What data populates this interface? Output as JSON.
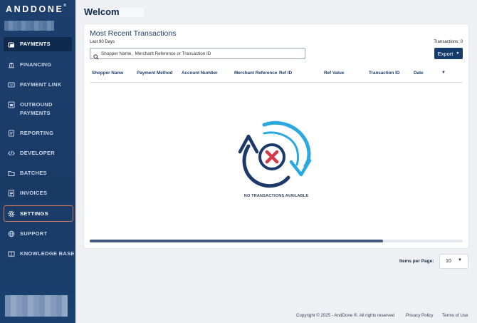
{
  "app": {
    "logo": "ANDDONE",
    "logo_mark": "®"
  },
  "sidebar": {
    "items": [
      {
        "label": "PAYMENTS",
        "icon": "payments-icon"
      },
      {
        "label": "FINANCING",
        "icon": "bank-icon"
      },
      {
        "label": "PAYMENT LINK",
        "icon": "payment-link-icon"
      },
      {
        "label": "OUTBOUND",
        "label2": "PAYMENTS",
        "icon": "outbound-payments-icon"
      },
      {
        "label": "REPORTING",
        "icon": "report-icon"
      },
      {
        "label": "DEVELOPER",
        "icon": "code-icon"
      },
      {
        "label": "BATCHES",
        "icon": "folder-icon"
      },
      {
        "label": "INVOICES",
        "icon": "invoice-icon"
      },
      {
        "label": "SETTINGS",
        "icon": "gear-icon"
      },
      {
        "label": "SUPPORT",
        "icon": "globe-icon"
      },
      {
        "label": "KNOWLEDGE BASE",
        "icon": "book-icon"
      }
    ]
  },
  "header": {
    "welcome": "Welcome,"
  },
  "transactions": {
    "title": "Most Recent Transactions",
    "subtitle": "Last 90 Days",
    "count_label": "Transactions: 0",
    "search_placeholder": "Shopper Name,  Merchant Reference or Transaction ID",
    "export_label": "Export",
    "columns": [
      "Shopper Name",
      "Payment Method",
      "Account Number",
      "Merchant Reference",
      "Ref ID",
      "Ref Value",
      "Transaction ID",
      "Date"
    ],
    "empty_message": "NO TRANSACTIONS AVAILABLE"
  },
  "pagination": {
    "label": "Items per Page:",
    "value": "10"
  },
  "footer": {
    "copyright": "Copyright © 2025 - AndDone ®. All rights reserved",
    "privacy": "Privacy Policy",
    "terms": "Terms of Use"
  },
  "colors": {
    "sidebar": "#1d3f6e",
    "accent": "#173c6b",
    "empty_icon_light": "#29a9e0",
    "empty_icon_dark": "#1b3a6b",
    "empty_icon_x": "#d6384a"
  }
}
